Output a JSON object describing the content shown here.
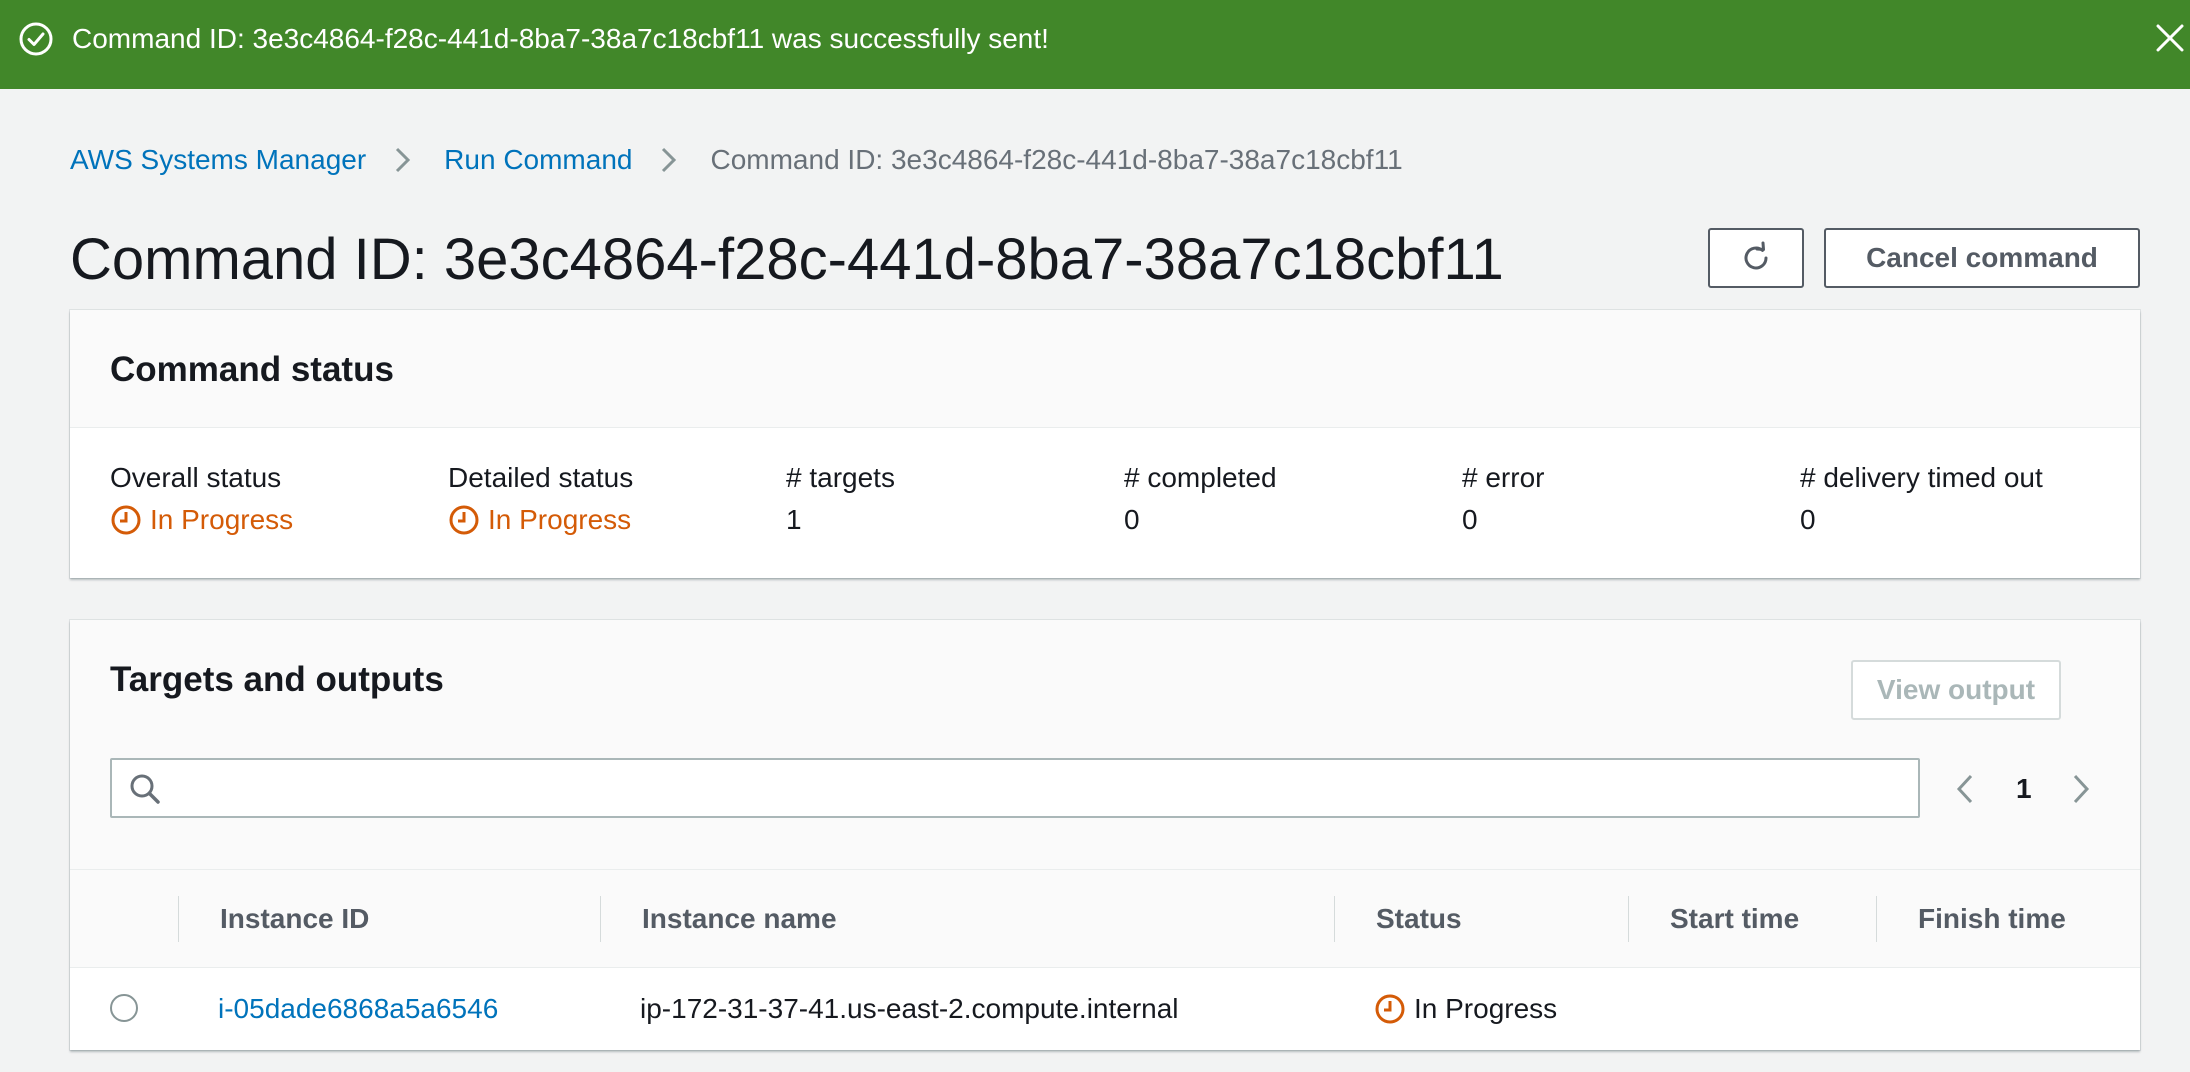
{
  "flash": {
    "message": "Command ID: 3e3c4864-f28c-441d-8ba7-38a7c18cbf11 was successfully sent!"
  },
  "breadcrumb": {
    "items": [
      "AWS Systems Manager",
      "Run Command"
    ],
    "current": "Command ID: 3e3c4864-f28c-441d-8ba7-38a7c18cbf11"
  },
  "header": {
    "title": "Command ID: 3e3c4864-f28c-441d-8ba7-38a7c18cbf11",
    "cancel_label": "Cancel command"
  },
  "command_status": {
    "title": "Command status",
    "fields": [
      {
        "label": "Overall status",
        "value": "In Progress"
      },
      {
        "label": "Detailed status",
        "value": "In Progress"
      },
      {
        "label": "# targets",
        "value": "1"
      },
      {
        "label": "# completed",
        "value": "0"
      },
      {
        "label": "# error",
        "value": "0"
      },
      {
        "label": "# delivery timed out",
        "value": "0"
      }
    ]
  },
  "targets": {
    "title": "Targets and outputs",
    "view_output_label": "View output",
    "search_placeholder": "",
    "page": "1",
    "columns": [
      "Instance ID",
      "Instance name",
      "Status",
      "Start time",
      "Finish time"
    ],
    "rows": [
      {
        "instance_id": "i-05dade6868a5a6546",
        "instance_name": "ip-172-31-37-41.us-east-2.compute.internal",
        "status": "In Progress",
        "start_time": "",
        "finish_time": ""
      }
    ]
  },
  "colors": {
    "success": "#418729",
    "in_progress": "#d45b07",
    "link": "#0073bb"
  },
  "icons": [
    "check-circle-icon",
    "close-icon",
    "chevron-right-icon",
    "refresh-icon",
    "clock-icon",
    "search-icon",
    "chevron-left-icon"
  ]
}
